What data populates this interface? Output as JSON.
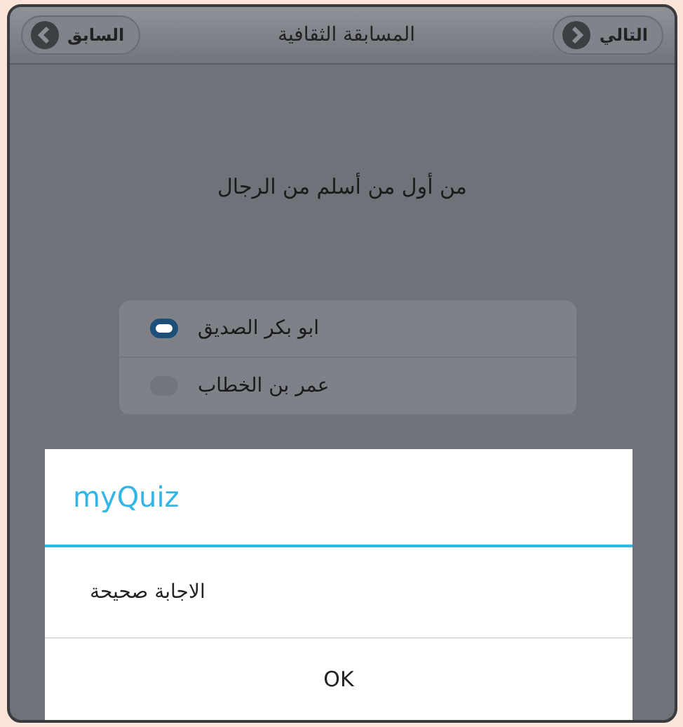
{
  "header": {
    "title": "المسابقة الثقافية",
    "next_button": "التالي",
    "previous_button": "السابق"
  },
  "question": "من أول من أسلم من الرجال",
  "options": [
    {
      "label": "ابو بكر الصديق",
      "selected": true
    },
    {
      "label": "عمر بن الخطاب",
      "selected": false
    }
  ],
  "dialog": {
    "title": "myQuiz",
    "message": "الاجابة صحيحة",
    "buttons": [
      "OK"
    ]
  }
}
